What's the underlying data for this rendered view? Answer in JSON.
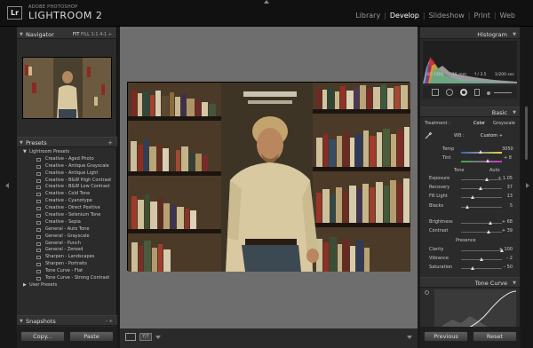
{
  "header": {
    "brand_small": "ADOBE PHOTOSHOP",
    "brand_big": "LIGHTROOM 2",
    "logo": "Lr",
    "modules": [
      "Library",
      "Develop",
      "Slideshow",
      "Print",
      "Web"
    ],
    "active_module": "Develop"
  },
  "left_panel": {
    "navigator": {
      "title": "Navigator",
      "zoom_options": [
        "FIT",
        "FILL",
        "1:1",
        "4:1 ÷"
      ]
    },
    "presets": {
      "title": "Presets",
      "add_icon": "+",
      "folder": "Lightroom Presets",
      "items": [
        "Creative - Aged Photo",
        "Creative - Antique Grayscale",
        "Creative - Antique Light",
        "Creative - B&W High Contrast",
        "Creative - B&W Low Contrast",
        "Creative - Cold Tone",
        "Creative - Cyanotype",
        "Creative - Direct Positive",
        "Creative - Selenium Tone",
        "Creative - Sepia",
        "General - Auto Tone",
        "General - Grayscale",
        "General - Punch",
        "General - Zeroed",
        "Sharpen - Landscapes",
        "Sharpen - Portraits",
        "Tone Curve - Flat",
        "Tone Curve - Strong Contrast"
      ],
      "user_folder": "User Presets"
    },
    "snapshots": {
      "title": "Snapshots",
      "controls": "– +"
    },
    "copy_button": "Copy...",
    "paste_button": "Paste"
  },
  "right_panel": {
    "histogram": {
      "title": "Histogram",
      "iso": "ISO 1600",
      "focal": "15 mm",
      "aperture": "f / 3.5",
      "shutter": "1/200 sec"
    },
    "basic": {
      "title": "Basic",
      "treatment_label": "Treatment :",
      "color": "Color",
      "grayscale": "Grayscale",
      "wb_label": "WB :",
      "wb_value": "Custom ÷",
      "temp_label": "Temp",
      "temp_value": "3050",
      "tint_label": "Tint",
      "tint_value": "+ 8",
      "tone_label": "Tone",
      "auto_label": "Auto",
      "sliders": [
        {
          "label": "Exposure",
          "value": "+ 1.05",
          "pos": 0.62
        },
        {
          "label": "Recovery",
          "value": "37",
          "pos": 0.45
        },
        {
          "label": "Fill Light",
          "value": "13",
          "pos": 0.25
        },
        {
          "label": "Blacks",
          "value": "5",
          "pos": 0.12
        },
        {
          "label": "Brightness",
          "value": "+ 68",
          "pos": 0.7
        },
        {
          "label": "Contrast",
          "value": "+ 39",
          "pos": 0.65
        }
      ],
      "presence_label": "Presence",
      "presence": [
        {
          "label": "Clarity",
          "value": "+ 100",
          "pos": 1.0
        },
        {
          "label": "Vibrance",
          "value": "– 2",
          "pos": 0.48
        },
        {
          "label": "Saturation",
          "value": "– 50",
          "pos": 0.25
        }
      ]
    },
    "tone_curve": {
      "title": "Tone Curve"
    },
    "previous_button": "Previous",
    "reset_button": "Reset"
  }
}
